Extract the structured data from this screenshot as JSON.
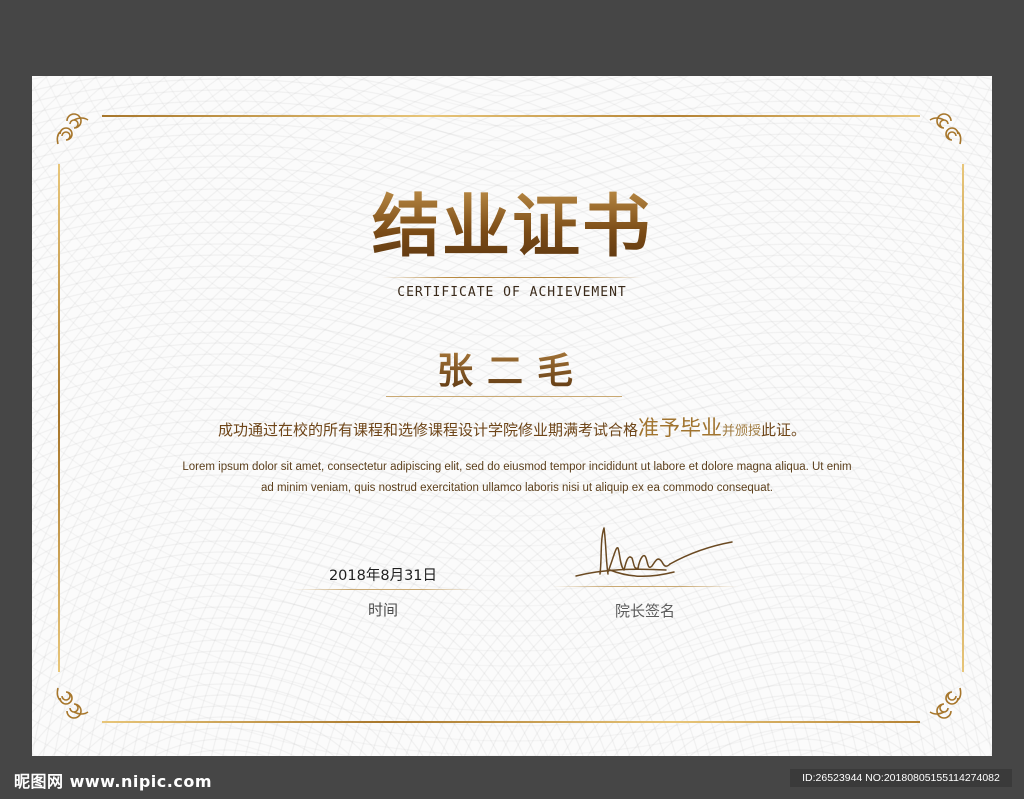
{
  "certificate": {
    "title": "结业证书",
    "subtitle": "CERTIFICATE OF ACHIEVEMENT",
    "recipient_name": "张二毛",
    "statement": {
      "part1": "成功通过在校的所有课程和选修课程设计学院修业期满考试合格",
      "highlight": "准予毕业",
      "part2": "并颁授",
      "part3": "此证。"
    },
    "lorem_line1": "Lorem ipsum dolor sit amet, consectetur adipiscing elit, sed do eiusmod tempor incididunt ut labore et dolore magna aliqua. Ut enim",
    "lorem_line2": "ad minim veniam, quis nostrud exercitation ullamco laboris nisi ut aliquip ex ea commodo consequat.",
    "date_value": "2018年8月31日",
    "date_label": "时间",
    "signature_label": "院长签名",
    "accent_color": "#8a5a20",
    "border_color": "#c9a06a"
  },
  "site": {
    "watermark": "昵图网 www.nipic.com",
    "image_id": "ID:26523944 NO:20180805155114274082"
  }
}
